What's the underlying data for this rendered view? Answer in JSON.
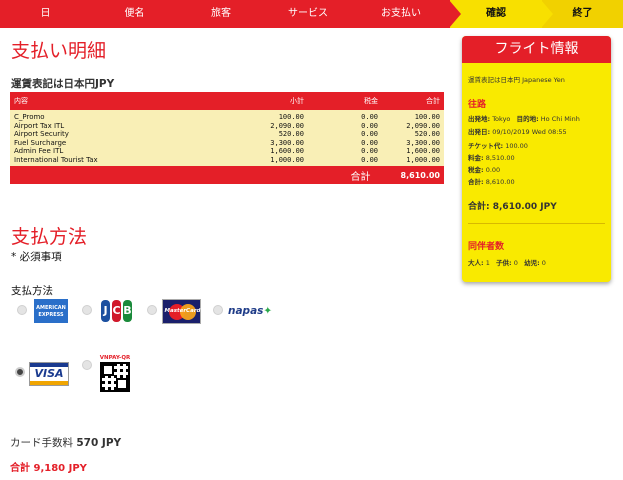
{
  "steps": [
    "日",
    "便名",
    "旅客",
    "サービス",
    "お支払い",
    "確認",
    "終了"
  ],
  "payment_detail": {
    "title": "支払い明細",
    "currency_note": "運賃表記は日本円JPY",
    "columns": [
      "内容",
      "小計",
      "税金",
      "合計"
    ],
    "rows": [
      {
        "item": "C_Promo",
        "subtotal": "100.00",
        "tax": "0.00",
        "total": "100.00"
      },
      {
        "item": "Airport Tax ITL",
        "subtotal": "2,090.00",
        "tax": "0.00",
        "total": "2,090.00"
      },
      {
        "item": "Airport Security",
        "subtotal": "520.00",
        "tax": "0.00",
        "total": "520.00"
      },
      {
        "item": "Fuel Surcharge",
        "subtotal": "3,300.00",
        "tax": "0.00",
        "total": "3,300.00"
      },
      {
        "item": "Admin Fee ITL",
        "subtotal": "1,600.00",
        "tax": "0.00",
        "total": "1,600.00"
      },
      {
        "item": "International Tourist Tax",
        "subtotal": "1,000.00",
        "tax": "0.00",
        "total": "1,000.00"
      }
    ],
    "footer_label": "合計",
    "footer_value": "8,610.00"
  },
  "payment_method": {
    "title": "支払方法",
    "required_note": "* 必須事項",
    "label": "支払方法",
    "options": [
      "AMERICAN EXPRESS",
      "JCB",
      "MasterCard",
      "napas",
      "VISA",
      "VNPAY-QR"
    ],
    "selected": "VISA",
    "amex_text": [
      "AMERICAN",
      "EXPRESS"
    ],
    "jcb_letters": [
      "J",
      "C",
      "B"
    ],
    "mastercard_text": "MasterCard",
    "napas_text": "napas",
    "visa_text": "VISA",
    "vnpay_text": "VNPAY-QR"
  },
  "card_fee": {
    "label": "カード手数料",
    "value": "570 JPY"
  },
  "grand_total": {
    "label": "合計",
    "value": "9,180 JPY"
  },
  "flight_info": {
    "title": "フライト情報",
    "currency_note": "運賃表記は日本円 Japanese Yen",
    "outbound_title": "往路",
    "departure_label": "出発地:",
    "departure": "Tokyo",
    "destination_label": "目的地:",
    "destination": "Ho Chi Minh",
    "date_label": "出発日:",
    "date": "09/10/2019 Wed 08:55",
    "ticket_label": "チケット代:",
    "ticket": "100.00",
    "fee_label": "料金:",
    "fee": "8,510.00",
    "tax_label": "税金:",
    "tax": "0.00",
    "sum_label": "合計:",
    "sum": "8,610.00",
    "total_label": "合計:",
    "total": "8,610.00 JPY",
    "companions_title": "同伴者数",
    "adult_label": "大人:",
    "adult": "1",
    "child_label": "子供:",
    "child": "0",
    "infant_label": "幼児:",
    "infant": "0"
  }
}
